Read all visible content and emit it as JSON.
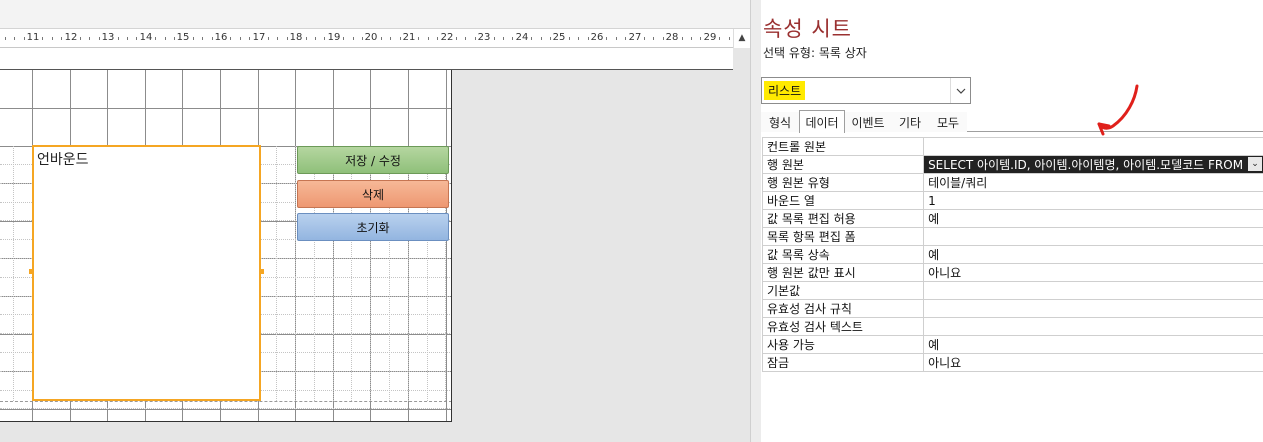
{
  "ruler": {
    "numbers": [
      "11",
      "12",
      "13",
      "14",
      "15",
      "16",
      "17",
      "18",
      "19",
      "20",
      "21",
      "22",
      "23",
      "24",
      "25",
      "26",
      "27",
      "28",
      "29"
    ]
  },
  "form": {
    "listbox_label": "언바운드",
    "buttons": {
      "save": "저장 / 수정",
      "delete": "삭제",
      "reset": "초기화"
    },
    "colors": {
      "save": "#9ccb86",
      "delete": "#f1a580",
      "reset": "#a3c2e7",
      "selection": "#f5a623"
    }
  },
  "property_sheet": {
    "title": "속성 시트",
    "selection_type": "선택 유형:  목록 상자",
    "object_combo": {
      "value": "리스트",
      "highlight": "#ffea00"
    },
    "tabs": [
      {
        "label": "형식",
        "active": false
      },
      {
        "label": "데이터",
        "active": true
      },
      {
        "label": "이벤트",
        "active": false
      },
      {
        "label": "기타",
        "active": false
      },
      {
        "label": "모두",
        "active": false
      }
    ],
    "properties": [
      {
        "name": "컨트롤 원본",
        "value": ""
      },
      {
        "name": "행 원본",
        "value": "SELECT 아이템.ID, 아이템.아이템명, 아이템.모델코드 FROM",
        "selected": true
      },
      {
        "name": "행 원본 유형",
        "value": "테이블/쿼리"
      },
      {
        "name": "바운드 열",
        "value": "1"
      },
      {
        "name": "값 목록 편집 허용",
        "value": "예"
      },
      {
        "name": "목록 항목 편집 폼",
        "value": ""
      },
      {
        "name": "값 목록 상속",
        "value": "예"
      },
      {
        "name": "행 원본 값만 표시",
        "value": "아니요"
      },
      {
        "name": "기본값",
        "value": ""
      },
      {
        "name": "유효성 검사 규칙",
        "value": ""
      },
      {
        "name": "유효성 검사 텍스트",
        "value": ""
      },
      {
        "name": "사용 가능",
        "value": "예"
      },
      {
        "name": "잠금",
        "value": "아니요"
      }
    ],
    "annotation_color": "#e0201b"
  },
  "icons": {
    "scroll_up": "scroll-up-arrow-icon",
    "combo_dropdown": "chevron-down-icon",
    "row_dropdown": "dropdown-arrow-icon",
    "annotation": "red-arrow-annotation-icon"
  }
}
